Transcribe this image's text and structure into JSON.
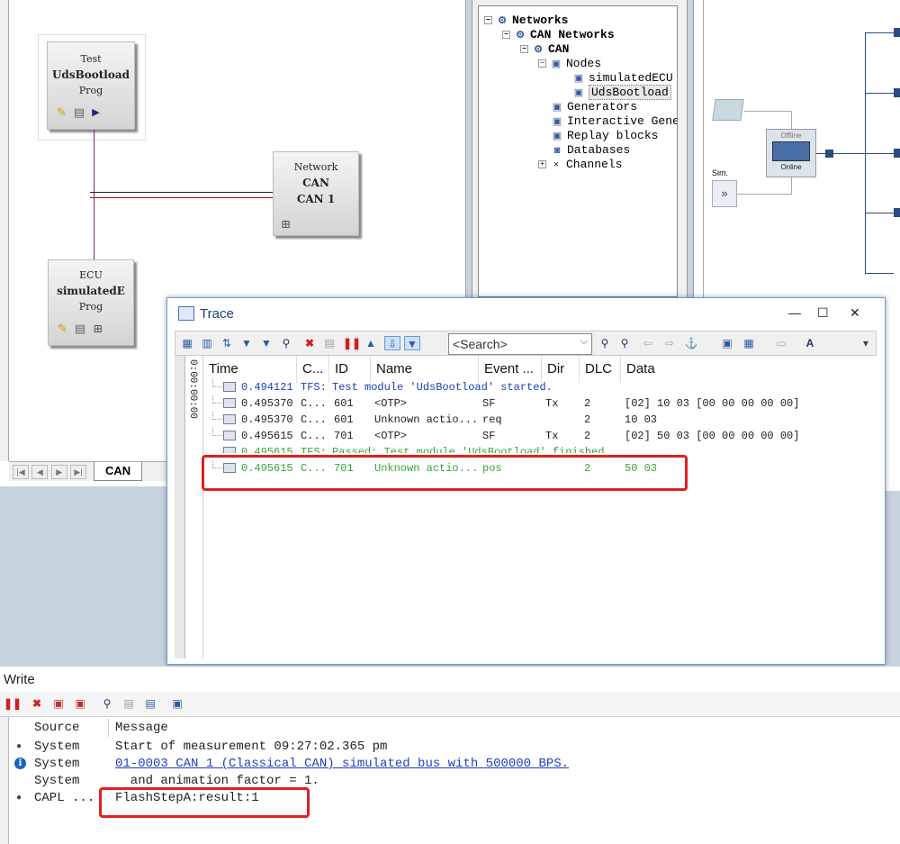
{
  "simulation_setup": {
    "blocks": [
      {
        "line1": "Test",
        "line2": "UdsBootload",
        "line3": "Prog"
      },
      {
        "line1": "Network",
        "line2": "CAN",
        "line3": "CAN 1"
      },
      {
        "line1": "ECU",
        "line2": "simulatedE",
        "line3": "Prog"
      }
    ],
    "tab_label": "CAN"
  },
  "network_tree": {
    "items": [
      {
        "label": "Networks"
      },
      {
        "label": "CAN Networks"
      },
      {
        "label": "CAN"
      },
      {
        "label": "Nodes"
      },
      {
        "label": "simulatedECU"
      },
      {
        "label": "UdsBootload"
      },
      {
        "label": "Generators"
      },
      {
        "label": "Interactive Gene"
      },
      {
        "label": "Replay blocks"
      },
      {
        "label": "Databases"
      },
      {
        "label": "Channels"
      }
    ]
  },
  "measurement_setup": {
    "switch_offline": "Offline",
    "switch_online": "Online",
    "sim_label": "Sim."
  },
  "trace": {
    "title": "Trace",
    "search_placeholder": "<Search>",
    "time_axis": "0:00:00:00",
    "columns": [
      "Time",
      "C...",
      "ID",
      "Name",
      "Event ...",
      "Dir",
      "DLC",
      "Data"
    ],
    "rows": [
      {
        "time": "0.494121",
        "chn": "TFS:",
        "id": "",
        "name": "Test module 'UdsBootload' started.",
        "event": "",
        "dir": "",
        "dlc": "",
        "data": "",
        "color": "#1a3fb5"
      },
      {
        "time": "0.495370",
        "chn": "C...",
        "id": "601",
        "name": "<OTP>",
        "event": "SF",
        "dir": "Tx",
        "dlc": "2",
        "data": "[02] 10 03 [00 00 00 00 00]",
        "color": "#222222"
      },
      {
        "time": "0.495370",
        "chn": "C...",
        "id": "601",
        "name": "Unknown actio...",
        "event": "req",
        "dir": "",
        "dlc": "2",
        "data": "10 03",
        "color": "#222222"
      },
      {
        "time": "0.495615",
        "chn": "C...",
        "id": "701",
        "name": "<OTP>",
        "event": "SF",
        "dir": "Tx",
        "dlc": "2",
        "data": "[02] 50 03 [00 00 00 00 00]",
        "color": "#222222"
      },
      {
        "time": "0.495615",
        "chn": "TFS:",
        "id": "",
        "name": "Passed: Test module 'UdsBootload' finished.",
        "event": "",
        "dir": "",
        "dlc": "",
        "data": "",
        "color": "#3aa33a"
      },
      {
        "time": "0.495615",
        "chn": "C...",
        "id": "701",
        "name": "Unknown actio...",
        "event": "pos",
        "dir": "",
        "dlc": "2",
        "data": "50 03",
        "color": "#3aa33a"
      }
    ]
  },
  "write": {
    "title": "Write",
    "col_source": "Source",
    "col_message": "Message",
    "rows": [
      {
        "source": "System",
        "message": "Start of measurement 09:27:02.365 pm"
      },
      {
        "source": "System",
        "message": "01-0003 CAN 1 (Classical CAN)  simulated bus with 500000 BPS."
      },
      {
        "source": "System",
        "message": "  and animation factor = 1."
      },
      {
        "source": "CAPL ...",
        "message": "FlashStepA:result:1"
      }
    ]
  },
  "colors": {
    "accent": "#1e3f7a",
    "highlight": "#e02020",
    "pass_green": "#3aa33a",
    "info_blue": "#1a3fb5",
    "link_blue": "#1f3fc0"
  }
}
